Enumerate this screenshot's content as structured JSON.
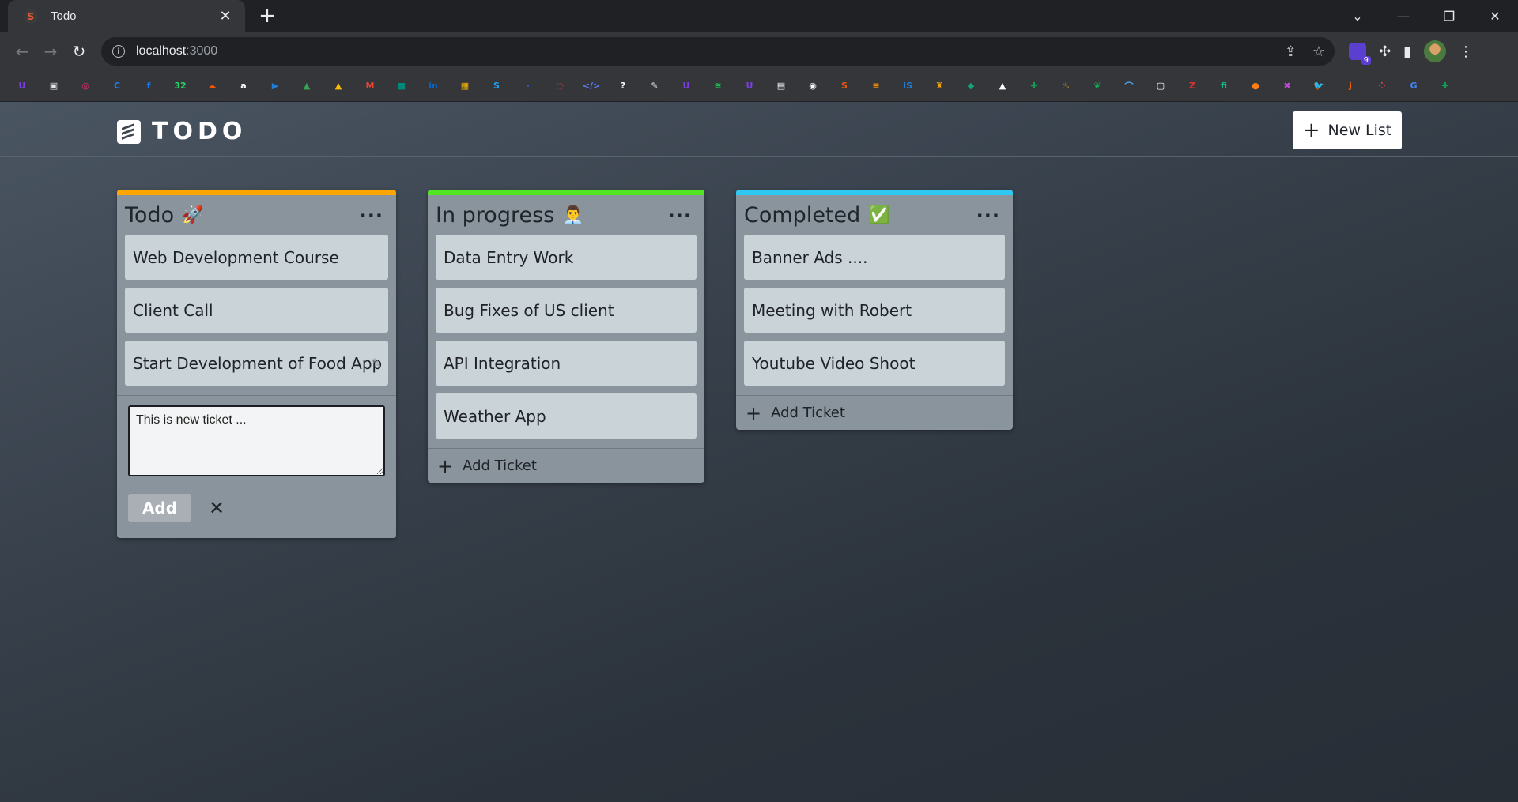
{
  "browser": {
    "tab_title": "Todo",
    "tab_favicon": "S",
    "tab_close": "✕",
    "new_tab": "+",
    "url_host": "localhost",
    "url_port": ":3000",
    "window_controls": [
      "⌄",
      "—",
      "❐",
      "✕"
    ],
    "extension_badge": "9",
    "bookmark_icons": [
      {
        "name": "uplabs-icon",
        "glyph": "U",
        "color": "#7b3fe4"
      },
      {
        "name": "image-icon",
        "glyph": "▣",
        "color": "#e6e6e6"
      },
      {
        "name": "instagram-icon",
        "glyph": "◎",
        "color": "#e1306c"
      },
      {
        "name": "c-icon",
        "glyph": "C",
        "color": "#1f7aec"
      },
      {
        "name": "facebook-icon",
        "glyph": "f",
        "color": "#1877f2"
      },
      {
        "name": "whatsapp-icon",
        "glyph": "32",
        "color": "#25d366"
      },
      {
        "name": "soundcloud-icon",
        "glyph": "☁",
        "color": "#ff5500"
      },
      {
        "name": "amazon-icon",
        "glyph": "a",
        "color": "#ffffff"
      },
      {
        "name": "play-icon",
        "glyph": "▶",
        "color": "#1c7ed6"
      },
      {
        "name": "drive-icon",
        "glyph": "▲",
        "color": "#34a853"
      },
      {
        "name": "drive2-icon",
        "glyph": "▲",
        "color": "#fbbc04"
      },
      {
        "name": "gmail-icon",
        "glyph": "M",
        "color": "#ea4335"
      },
      {
        "name": "meet-icon",
        "glyph": "■",
        "color": "#00897b"
      },
      {
        "name": "linkedin-icon",
        "glyph": "in",
        "color": "#0a66c2"
      },
      {
        "name": "photos-icon",
        "glyph": "▦",
        "color": "#f4b400"
      },
      {
        "name": "s-icon",
        "glyph": "S",
        "color": "#1da1f2"
      },
      {
        "name": "dot-icon",
        "glyph": "·",
        "color": "#3b5bdb"
      },
      {
        "name": "circle-icon",
        "glyph": "◌",
        "color": "#e03131"
      },
      {
        "name": "code-icon",
        "glyph": "</>",
        "color": "#5c7cfa"
      },
      {
        "name": "help-icon",
        "glyph": "?",
        "color": "#ffffff"
      },
      {
        "name": "feather-icon",
        "glyph": "✎",
        "color": "#dddddd"
      },
      {
        "name": "uplabs2-icon",
        "glyph": "U",
        "color": "#7b3fe4"
      },
      {
        "name": "spotify-icon",
        "glyph": "≋",
        "color": "#1db954"
      },
      {
        "name": "uplabs3-icon",
        "glyph": "U",
        "color": "#7b3fe4"
      },
      {
        "name": "doc-icon",
        "glyph": "▤",
        "color": "#ffffff"
      },
      {
        "name": "record-icon",
        "glyph": "◉",
        "color": "#ffffff"
      },
      {
        "name": "s2-icon",
        "glyph": "S",
        "color": "#e8590c"
      },
      {
        "name": "bars-icon",
        "glyph": "≡",
        "color": "#f08c00"
      },
      {
        "name": "is-icon",
        "glyph": "IS",
        "color": "#1c7ed6"
      },
      {
        "name": "cup-icon",
        "glyph": "♜",
        "color": "#f59f00"
      },
      {
        "name": "diamond-icon",
        "glyph": "◆",
        "color": "#0ca678"
      },
      {
        "name": "triangle-icon",
        "glyph": "▲",
        "color": "#ffffff"
      },
      {
        "name": "sheets-icon",
        "glyph": "✚",
        "color": "#0f9d58"
      },
      {
        "name": "firebase-icon",
        "glyph": "♨",
        "color": "#ffca28"
      },
      {
        "name": "mongodb-icon",
        "glyph": "❦",
        "color": "#13aa52"
      },
      {
        "name": "bridge-icon",
        "glyph": "⌒",
        "color": "#4dabf7"
      },
      {
        "name": "chat-icon",
        "glyph": "▢",
        "color": "#ffffff"
      },
      {
        "name": "z-icon",
        "glyph": "Z",
        "color": "#e03131"
      },
      {
        "name": "fi-icon",
        "glyph": "fi",
        "color": "#12b886"
      },
      {
        "name": "orb-icon",
        "glyph": "●",
        "color": "#fd7e14"
      },
      {
        "name": "cross-icon",
        "glyph": "✖",
        "color": "#be4bdb"
      },
      {
        "name": "twitter-icon",
        "glyph": "🐦",
        "color": "#1da1f2"
      },
      {
        "name": "j-icon",
        "glyph": "j",
        "color": "#f76707"
      },
      {
        "name": "monday-icon",
        "glyph": "⁘",
        "color": "#ff3d57"
      },
      {
        "name": "g-icon",
        "glyph": "G",
        "color": "#4285f4"
      },
      {
        "name": "sheets2-icon",
        "glyph": "✚",
        "color": "#0f9d58"
      }
    ]
  },
  "app": {
    "logo_text": "TODO",
    "new_list_label": "New List",
    "lists": [
      {
        "title": "Todo",
        "emoji": "🚀",
        "accent": "#ffa500",
        "cards": [
          "Web Development Course",
          "Client Call",
          "Start Development of Food App"
        ],
        "composer": {
          "value": "This is new ticket ...",
          "add_label": "Add",
          "cancel": "✕"
        }
      },
      {
        "title": "In progress",
        "emoji": "👨‍💼",
        "accent": "#52e521",
        "cards": [
          "Data Entry Work",
          "Bug Fixes of US client",
          "API Integration",
          "Weather App"
        ],
        "add_ticket_label": "Add Ticket"
      },
      {
        "title": "Completed",
        "emoji": "✅",
        "accent": "#2ec8f2",
        "cards": [
          "Banner Ads ....",
          "Meeting with Robert",
          "Youtube Video Shoot"
        ],
        "add_ticket_label": "Add Ticket"
      }
    ]
  }
}
